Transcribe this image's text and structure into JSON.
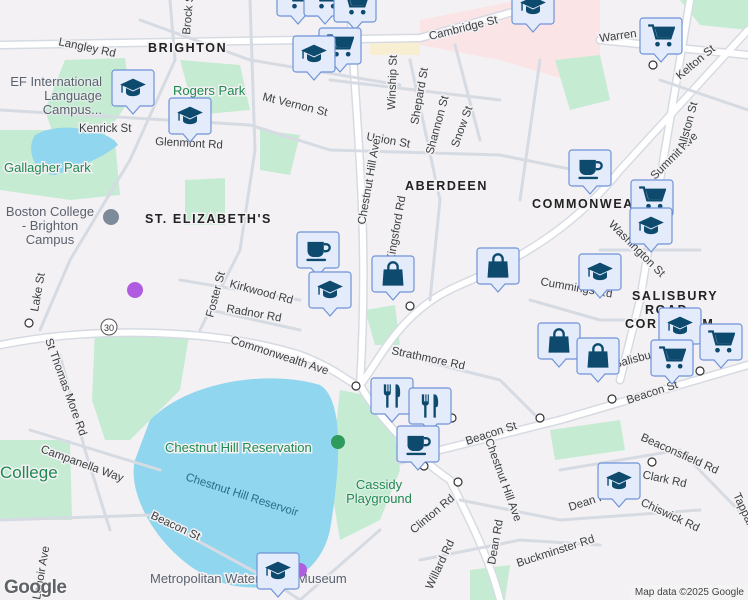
{
  "map": {
    "neighborhoods": [
      "BRIGHTON",
      "ABERDEEN",
      "ST. ELIZABETH'S",
      "COMMONWEALTH",
      "SALISBURY",
      "ROAD -",
      "CORE FARM"
    ],
    "streets": [
      "Langley Rd",
      "Brock St",
      "Cambridge St",
      "Warren St",
      "Kelton St",
      "Mt Vernon St",
      "Kenrick St",
      "Glenmont Rd",
      "Winship St",
      "Shepard St",
      "Shannon St",
      "Snow St",
      "Union St",
      "Chestnut Hill Ave",
      "Summit Ave",
      "Allston St",
      "Washington St",
      "Foster St",
      "Kirkwood Rd",
      "Radnor Rd",
      "Lake St",
      "St Thomas More Rd",
      "Commonwealth Ave",
      "Strathmore Rd",
      "Cummings Rd",
      "Beacon St",
      "Beaconsfield Rd",
      "Clark Rd",
      "Dean Rd",
      "Chiswick Rd",
      "Clinton Rd",
      "Willard Rd",
      "Buckminster Rd",
      "Campanella Way",
      "Tappan St",
      "Kingsford Rd",
      "Salisbury Rd",
      "Chestnut Hill Reservoir",
      "Lenoir Ave"
    ],
    "parks": [
      "Rogers Park",
      "Gallagher Park",
      "Chestnut Hill Reservation",
      "Cassidy Playground",
      "College"
    ],
    "pois": [
      "EF International Language Campus...",
      "Boston College - Brighton Campus",
      "Metropolitan Waterworks Museum"
    ],
    "route_shields": [
      "30"
    ],
    "markers": [
      "graduation-cap",
      "graduation-cap",
      "graduation-cap",
      "graduation-cap",
      "graduation-cap",
      "graduation-cap",
      "graduation-cap",
      "graduation-cap",
      "graduation-cap",
      "graduation-cap",
      "shopping-cart",
      "shopping-cart",
      "shopping-cart",
      "shopping-cart",
      "shopping-cart",
      "shopping-cart",
      "shopping-cart",
      "coffee-cup",
      "coffee-cup",
      "coffee-cup",
      "shopping-bag",
      "shopping-bag",
      "shopping-bag",
      "shopping-bag",
      "restaurant",
      "restaurant"
    ]
  },
  "branding": {
    "logo": "Google",
    "attribution": "Map data ©2025 Google"
  },
  "colors": {
    "marker_fill": "#e4ecfb",
    "marker_border": "#6f93d8",
    "icon": "#0d4a6e",
    "park": "#c5ecd3",
    "water": "#8fd6ee"
  }
}
